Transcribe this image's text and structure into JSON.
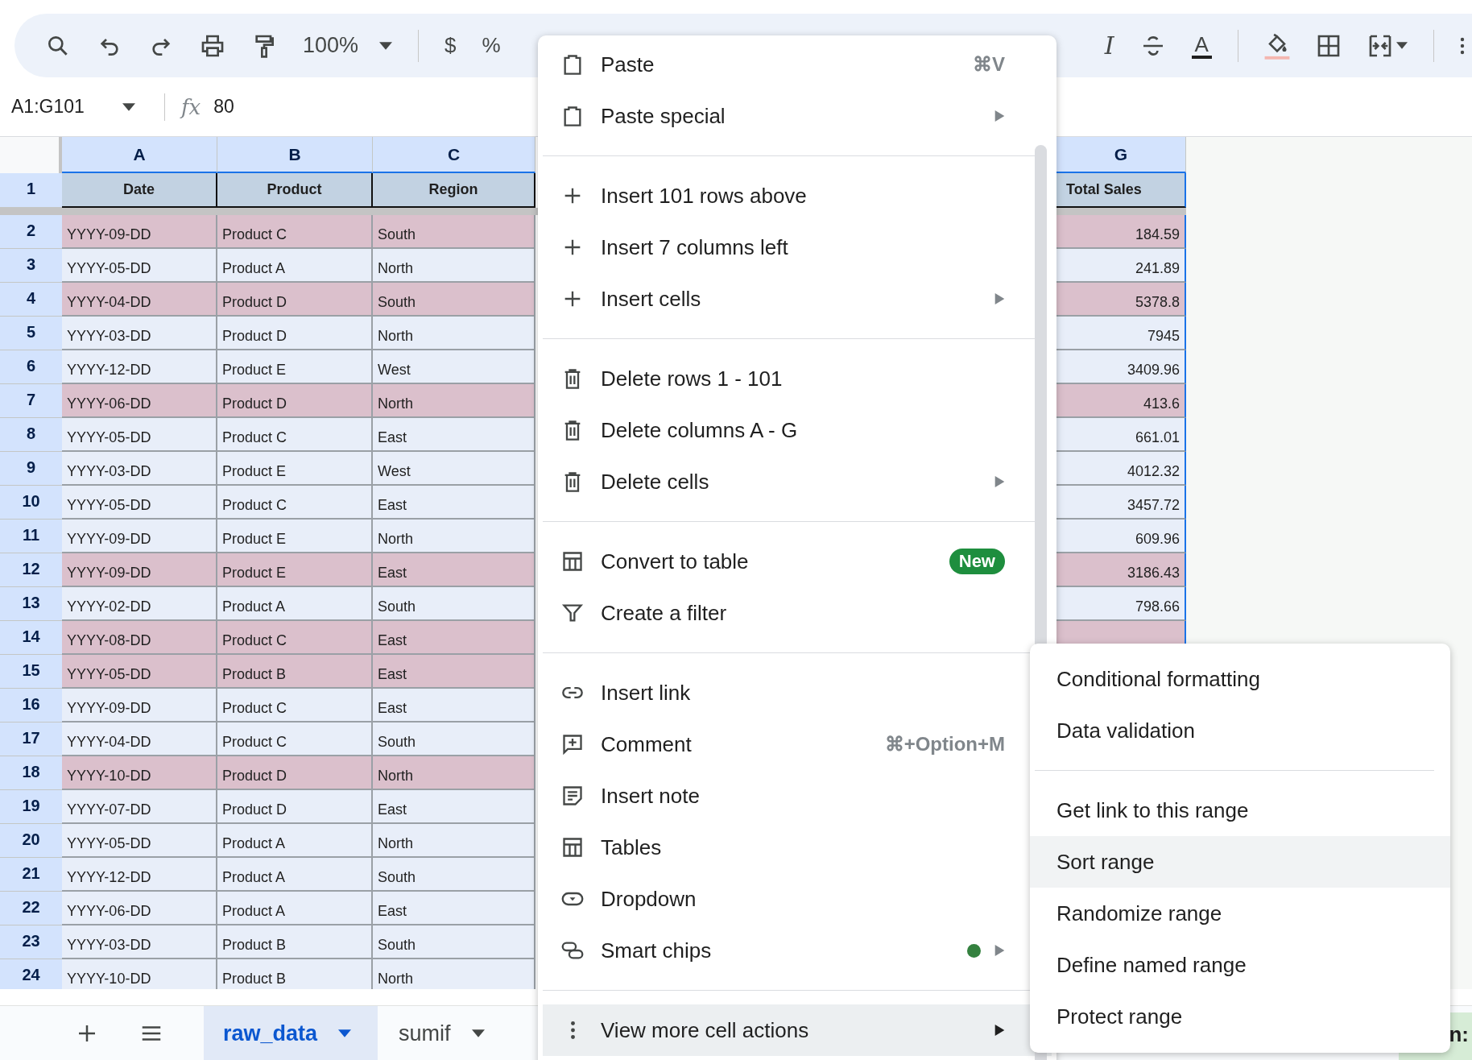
{
  "toolbar": {
    "zoom": "100%",
    "currency": "$",
    "percent": "%",
    "italic": "I",
    "text_color": "A"
  },
  "formula_bar": {
    "name_box": "A1:G101",
    "function_label": "fx",
    "value": "80"
  },
  "grid": {
    "column_headers": [
      "A",
      "B",
      "C",
      "G"
    ],
    "header_row": {
      "number": "1",
      "cells": [
        "Date",
        "Product",
        "Region",
        "Total Sales"
      ]
    },
    "rows": [
      {
        "number": "2",
        "highlighted": true,
        "cells": [
          "YYYY-09-DD",
          "Product C",
          "South",
          "184.59"
        ]
      },
      {
        "number": "3",
        "highlighted": false,
        "cells": [
          "YYYY-05-DD",
          "Product A",
          "North",
          "241.89"
        ]
      },
      {
        "number": "4",
        "highlighted": true,
        "cells": [
          "YYYY-04-DD",
          "Product D",
          "South",
          "5378.8"
        ]
      },
      {
        "number": "5",
        "highlighted": false,
        "cells": [
          "YYYY-03-DD",
          "Product D",
          "North",
          "7945"
        ]
      },
      {
        "number": "6",
        "highlighted": false,
        "cells": [
          "YYYY-12-DD",
          "Product E",
          "West",
          "3409.96"
        ]
      },
      {
        "number": "7",
        "highlighted": true,
        "cells": [
          "YYYY-06-DD",
          "Product D",
          "North",
          "413.6"
        ]
      },
      {
        "number": "8",
        "highlighted": false,
        "cells": [
          "YYYY-05-DD",
          "Product C",
          "East",
          "661.01"
        ]
      },
      {
        "number": "9",
        "highlighted": false,
        "cells": [
          "YYYY-03-DD",
          "Product E",
          "West",
          "4012.32"
        ]
      },
      {
        "number": "10",
        "highlighted": false,
        "cells": [
          "YYYY-05-DD",
          "Product C",
          "East",
          "3457.72"
        ]
      },
      {
        "number": "11",
        "highlighted": false,
        "cells": [
          "YYYY-09-DD",
          "Product E",
          "North",
          "609.96"
        ]
      },
      {
        "number": "12",
        "highlighted": true,
        "cells": [
          "YYYY-09-DD",
          "Product E",
          "East",
          "3186.43"
        ]
      },
      {
        "number": "13",
        "highlighted": false,
        "cells": [
          "YYYY-02-DD",
          "Product A",
          "South",
          "798.66"
        ]
      },
      {
        "number": "14",
        "highlighted": true,
        "cells": [
          "YYYY-08-DD",
          "Product C",
          "East"
        ]
      },
      {
        "number": "15",
        "highlighted": true,
        "cells": [
          "YYYY-05-DD",
          "Product B",
          "East"
        ]
      },
      {
        "number": "16",
        "highlighted": false,
        "cells": [
          "YYYY-09-DD",
          "Product C",
          "East"
        ]
      },
      {
        "number": "17",
        "highlighted": false,
        "cells": [
          "YYYY-04-DD",
          "Product C",
          "South"
        ]
      },
      {
        "number": "18",
        "highlighted": true,
        "cells": [
          "YYYY-10-DD",
          "Product D",
          "North"
        ]
      },
      {
        "number": "19",
        "highlighted": false,
        "cells": [
          "YYYY-07-DD",
          "Product D",
          "East"
        ]
      },
      {
        "number": "20",
        "highlighted": false,
        "cells": [
          "YYYY-05-DD",
          "Product A",
          "North"
        ]
      },
      {
        "number": "21",
        "highlighted": false,
        "cells": [
          "YYYY-12-DD",
          "Product A",
          "South"
        ]
      },
      {
        "number": "22",
        "highlighted": false,
        "cells": [
          "YYYY-06-DD",
          "Product A",
          "East"
        ]
      },
      {
        "number": "23",
        "highlighted": false,
        "cells": [
          "YYYY-03-DD",
          "Product B",
          "South"
        ]
      },
      {
        "number": "24",
        "highlighted": false,
        "cells": [
          "YYYY-10-DD",
          "Product B",
          "North"
        ]
      }
    ]
  },
  "context_menu": {
    "sections": [
      [
        {
          "label": "Paste",
          "shortcut": "⌘V",
          "submenu": false,
          "dot": false,
          "selected": false
        },
        {
          "label": "Paste special",
          "submenu": true,
          "dot": false,
          "selected": false
        }
      ],
      [
        {
          "label": "Insert 101 rows above",
          "submenu": false,
          "dot": false,
          "selected": false
        },
        {
          "label": "Insert 7 columns left",
          "submenu": false,
          "dot": false,
          "selected": false
        },
        {
          "label": "Insert cells",
          "submenu": true,
          "dot": false,
          "selected": false
        }
      ],
      [
        {
          "label": "Delete rows 1 - 101",
          "submenu": false,
          "dot": false,
          "selected": false
        },
        {
          "label": "Delete columns A - G",
          "submenu": false,
          "dot": false,
          "selected": false
        },
        {
          "label": "Delete cells",
          "submenu": true,
          "dot": false,
          "selected": false
        }
      ],
      [
        {
          "label": "Convert to table",
          "badge": "New",
          "submenu": false,
          "dot": false,
          "selected": false
        },
        {
          "label": "Create a filter",
          "submenu": false,
          "dot": false,
          "selected": false
        }
      ],
      [
        {
          "label": "Insert link",
          "submenu": false,
          "dot": false,
          "selected": false
        },
        {
          "label": "Comment",
          "shortcut": "⌘+Option+M",
          "submenu": false,
          "dot": false,
          "selected": false
        },
        {
          "label": "Insert note",
          "submenu": false,
          "dot": false,
          "selected": false
        },
        {
          "label": "Tables",
          "submenu": false,
          "dot": false,
          "selected": false
        },
        {
          "label": "Dropdown",
          "submenu": false,
          "dot": false,
          "selected": false
        },
        {
          "label": "Smart chips",
          "submenu": true,
          "dot": true,
          "selected": false
        }
      ],
      [
        {
          "label": "View more cell actions",
          "submenu": true,
          "dot": false,
          "selected": true
        }
      ]
    ]
  },
  "submenu": {
    "sections": [
      [
        {
          "label": "Conditional formatting",
          "selected": false
        },
        {
          "label": "Data validation",
          "selected": false
        }
      ],
      [
        {
          "label": "Get link to this range",
          "selected": false
        },
        {
          "label": "Sort range",
          "selected": true
        },
        {
          "label": "Randomize range",
          "selected": false
        },
        {
          "label": "Define named range",
          "selected": false
        },
        {
          "label": "Protect range",
          "selected": false
        }
      ]
    ]
  },
  "sheet_tabs": [
    {
      "label": "raw_data",
      "selected": true
    },
    {
      "label": "sumif",
      "selected": false
    }
  ],
  "side_panel_fragment": "n:"
}
